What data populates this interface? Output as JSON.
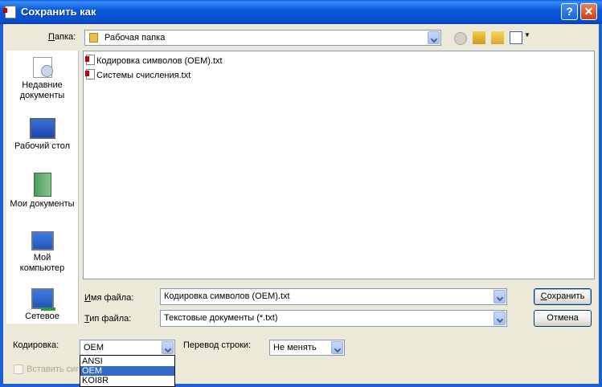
{
  "window": {
    "title": "Сохранить как",
    "help_symbol": "?",
    "close_symbol": "✕"
  },
  "toolbar": {
    "folder_label_prefix": "",
    "folder_label_accel": "П",
    "folder_label_rest": "апка:",
    "folder_value": "Рабочая папка",
    "icons": [
      "back-icon",
      "up-folder-icon",
      "new-folder-icon",
      "view-menu-icon"
    ]
  },
  "places": [
    {
      "name": "recent",
      "label": "Недавние документы"
    },
    {
      "name": "desktop",
      "label": "Рабочий стол"
    },
    {
      "name": "my-documents",
      "label": "Мои документы"
    },
    {
      "name": "my-computer",
      "label": "Мой компьютер"
    },
    {
      "name": "network",
      "label": "Сетевое"
    }
  ],
  "files": [
    {
      "name": "Кодировка символов (OEM).txt"
    },
    {
      "name": "Системы счисления.txt"
    }
  ],
  "form": {
    "filename_accel": "И",
    "filename_label_rest": "мя файла:",
    "filename_value": "Кодировка символов (OEM).txt",
    "filetype_accel": "Т",
    "filetype_label_rest": "ип файла:",
    "filetype_value": "Текстовые документы (*.txt)",
    "save_accel": "С",
    "save_rest": "охранить",
    "cancel_label": "Отмена",
    "encoding_label": "Кодировка:",
    "encoding_value": "OEM",
    "encoding_options": [
      "ANSI",
      "OEM",
      "KOI8R"
    ],
    "encoding_selected": "OEM",
    "linebreak_label": "Перевод строки:",
    "linebreak_value": "Не менять",
    "insert_sig_label": "Вставить сиг"
  },
  "colors": {
    "title_bar": "#0a5fe8",
    "dialog_bg": "#ece9d8",
    "selection": "#316ac5"
  }
}
